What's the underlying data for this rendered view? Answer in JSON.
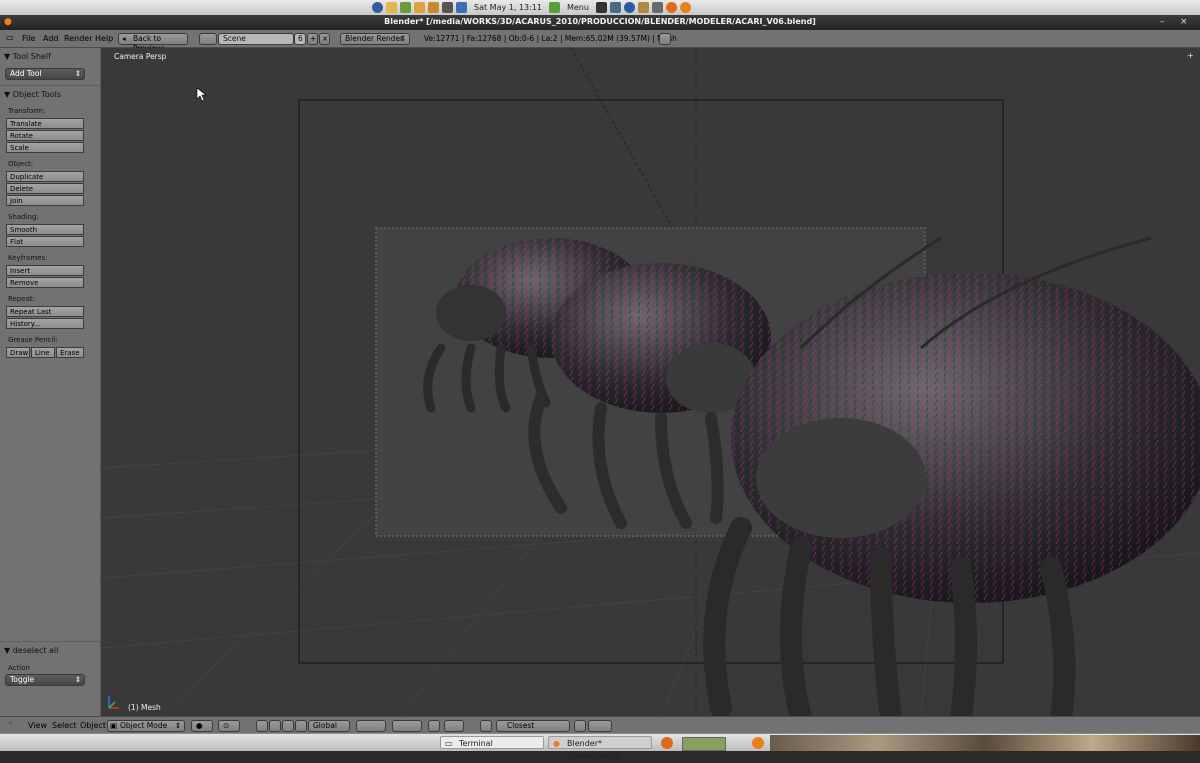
{
  "system_bar": {
    "clock": "Sat May  1, 13:11",
    "menu_label": "Menu",
    "icons": [
      "ubuntu-icon",
      "mail-icon",
      "chat-icon",
      "user-icon",
      "lock-icon",
      "volume-icon",
      "network-signal-icon",
      "terminal-icon",
      "display-icon",
      "browser-icon",
      "folder-icon",
      "firefox-icon",
      "blender-icon"
    ]
  },
  "window": {
    "title": "Blender* [/media/WORKS/3D/ACARUS_2010/PRODUCCION/BLENDER/MODELER/ACARI_V06.blend]",
    "minimize": "–",
    "close": "×"
  },
  "header": {
    "menus": [
      "File",
      "Add",
      "Render",
      "Help"
    ],
    "back_button": "Back to Previous",
    "scene_name": "Scene",
    "scene_users": "6",
    "render_engine": "Blender Render",
    "stats": "Ve:12771 | Fa:12768 | Ob:0-6 | La:2 | Mem:65.02M (39.57M) | Mesh"
  },
  "tool_shelf": {
    "title": "Tool Shelf",
    "add_tool": "Add Tool",
    "object_tools": "Object Tools",
    "groups": [
      {
        "label": "Transform:",
        "buttons": [
          "Translate",
          "Rotate",
          "Scale"
        ]
      },
      {
        "label": "Object:",
        "buttons": [
          "Duplicate",
          "Delete",
          "Join"
        ]
      },
      {
        "label": "Shading:",
        "buttons": [
          "Smooth",
          "Flat"
        ]
      },
      {
        "label": "Keyframes:",
        "buttons": [
          "Insert",
          "Remove"
        ]
      },
      {
        "label": "Repeat:",
        "buttons": [
          "Repeat Last",
          "History..."
        ]
      },
      {
        "label": "Grease Pencil:",
        "buttons": [
          "Draw",
          "Line",
          "Erase"
        ]
      }
    ],
    "operator_panel": "deselect all",
    "action_label": "Action",
    "action_value": "Toggle"
  },
  "viewport": {
    "view_name": "Camera Persp",
    "object_info": "(1) Mesh"
  },
  "bottom_header": {
    "menus": [
      "View",
      "Select",
      "Object"
    ],
    "mode": "Object Mode",
    "orientation": "Global",
    "snap": "Closest"
  },
  "taskbar": {
    "tasks": [
      "Terminal",
      "Blender* [/media/WOR..."
    ]
  },
  "colors": {
    "ui_grey": "#727272",
    "viewport_bg": "#393939",
    "hair_magenta": "#c020c0"
  }
}
